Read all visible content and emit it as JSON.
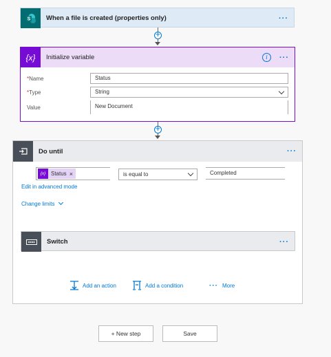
{
  "trigger": {
    "title": "When a file is created (properties only)",
    "icon": "sharepoint-icon"
  },
  "init_var": {
    "title": "Initialize variable",
    "name_label": "Name",
    "name_value": "Status",
    "type_label": "Type",
    "type_value": "String",
    "value_label": "Value",
    "value_value": "New Document",
    "required_mark": "*"
  },
  "do_until": {
    "title": "Do until",
    "token": "Status",
    "token_close": "×",
    "operator": "is equal to",
    "compare_value": "Completed",
    "advanced_link": "Edit in advanced mode",
    "change_limits": "Change limits"
  },
  "switch": {
    "title": "Switch"
  },
  "actions": {
    "add_action": "Add an action",
    "add_condition": "Add a condition",
    "more": "More"
  },
  "footer": {
    "new_step": "+ New step",
    "save": "Save"
  },
  "colors": {
    "accent": "#0078d4",
    "variable": "#770bd6",
    "sharepoint": "#036c70",
    "control": "#484f58"
  }
}
